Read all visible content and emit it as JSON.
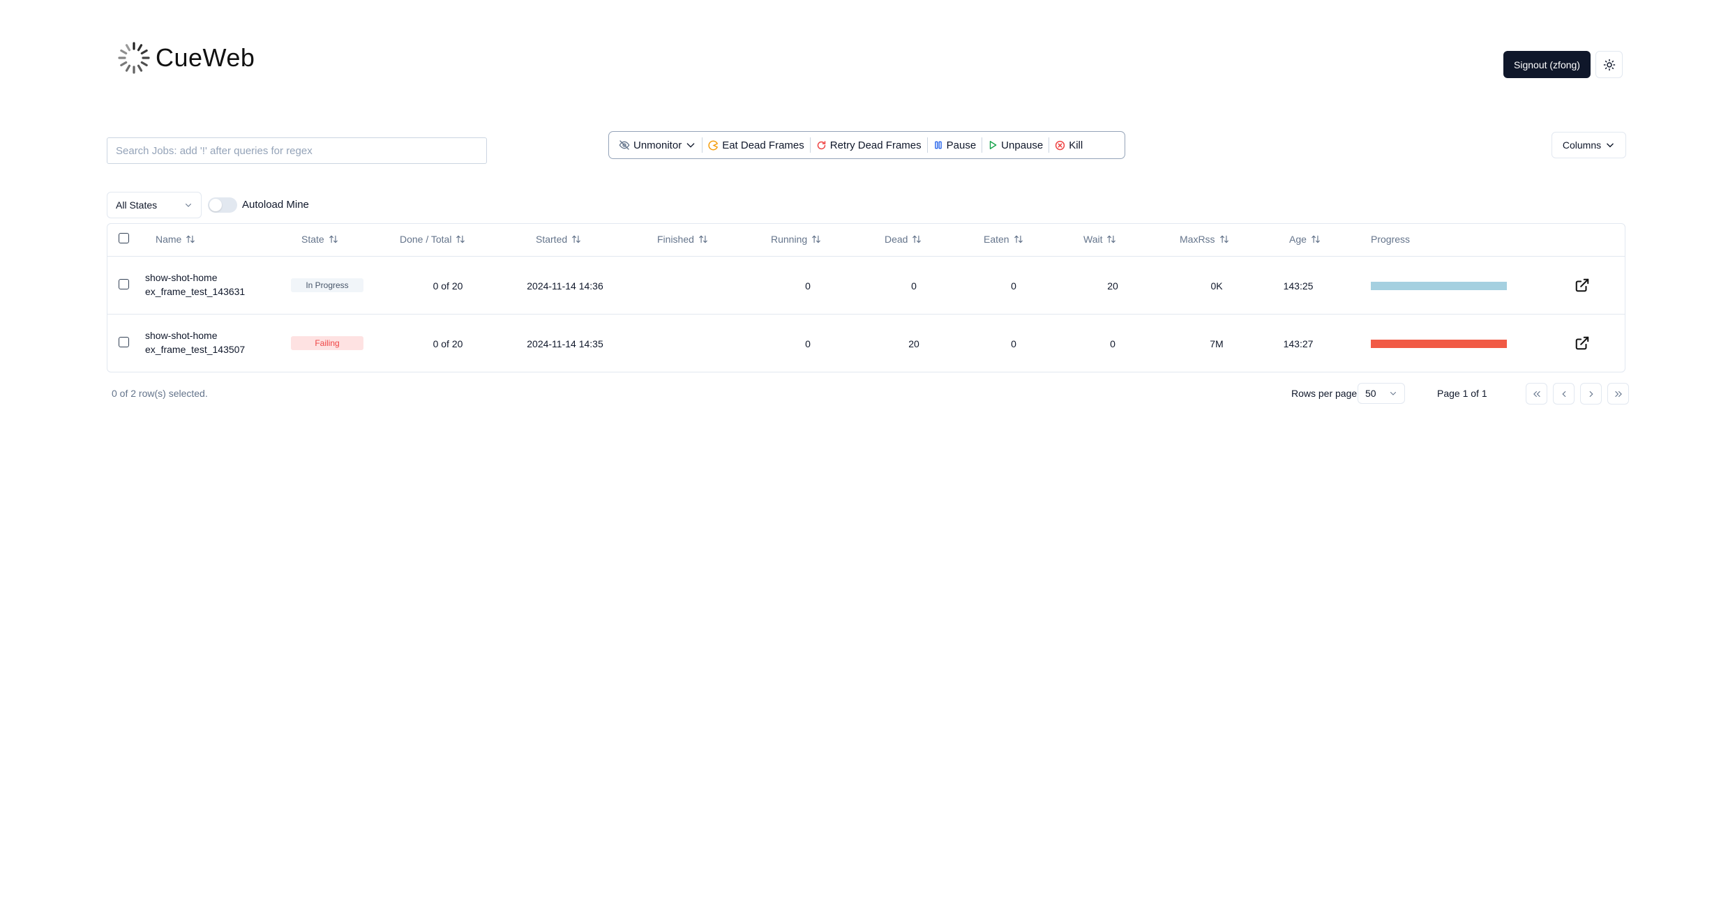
{
  "app": {
    "title": "CueWeb",
    "signout_label": "Signout (zfong)"
  },
  "search": {
    "placeholder": "Search Jobs: add '!' after queries for regex",
    "value": ""
  },
  "actions": [
    {
      "label": "Unmonitor",
      "icon": "eye-off-icon"
    },
    {
      "label": "Eat Dead Frames",
      "icon": "pacman-icon",
      "color": "#f59e0b"
    },
    {
      "label": "Retry Dead Frames",
      "icon": "retry-icon",
      "color": "#ef4444"
    },
    {
      "label": "Pause",
      "icon": "pause-icon",
      "color": "#2563eb"
    },
    {
      "label": "Unpause",
      "icon": "play-icon",
      "color": "#16a34a"
    },
    {
      "label": "Kill",
      "icon": "x-circle-icon",
      "color": "#ef4444"
    }
  ],
  "columns_button": "Columns",
  "filters": {
    "state_select": "All States",
    "autoload_label": "Autoload Mine",
    "autoload_on": false
  },
  "table": {
    "headers": [
      "Name",
      "State",
      "Done / Total",
      "Started",
      "Finished",
      "Running",
      "Dead",
      "Eaten",
      "Wait",
      "MaxRss",
      "Age",
      "Progress"
    ],
    "rows": [
      {
        "name_line1": "show-shot-home",
        "name_line2": "ex_frame_test_143631",
        "state": "In Progress",
        "done_total": "0 of 20",
        "started": "2024-11-14 14:36",
        "finished": "",
        "running": "0",
        "dead": "0",
        "eaten": "0",
        "wait": "20",
        "maxrss": "0K",
        "age": "143:25",
        "progress_fraction": 1.0,
        "progress_color": "#a5d0e0"
      },
      {
        "name_line1": "show-shot-home",
        "name_line2": "ex_frame_test_143507",
        "state": "Failing",
        "done_total": "0 of 20",
        "started": "2024-11-14 14:35",
        "finished": "",
        "running": "0",
        "dead": "20",
        "eaten": "0",
        "wait": "0",
        "maxrss": "7M",
        "age": "143:27",
        "progress_fraction": 1.0,
        "progress_color": "#f15a45"
      }
    ]
  },
  "footer": {
    "selected_text": "0 of 2 row(s) selected.",
    "rows_per_page_label": "Rows per page",
    "rows_per_page_value": "50",
    "page_text": "Page 1 of 1"
  }
}
